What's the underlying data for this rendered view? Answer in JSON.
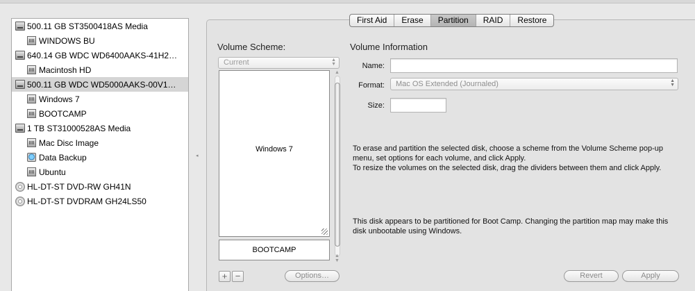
{
  "sidebar": {
    "items": [
      {
        "label": "500.11 GB ST3500418AS Media",
        "kind": "disk"
      },
      {
        "label": "WINDOWS BU",
        "kind": "volume"
      },
      {
        "label": "640.14 GB WDC WD6400AAKS-41H2…",
        "kind": "disk"
      },
      {
        "label": "Macintosh HD",
        "kind": "volume"
      },
      {
        "label": "500.11 GB WDC WD5000AAKS-00V1…",
        "kind": "disk",
        "selected": true
      },
      {
        "label": "Windows 7",
        "kind": "volume"
      },
      {
        "label": "BOOTCAMP",
        "kind": "volume"
      },
      {
        "label": "1 TB ST31000528AS Media",
        "kind": "disk"
      },
      {
        "label": "Mac Disc Image",
        "kind": "volume"
      },
      {
        "label": "Data Backup",
        "kind": "timemachine-volume"
      },
      {
        "label": "Ubuntu",
        "kind": "volume"
      },
      {
        "label": "HL-DT-ST DVD-RW GH41N",
        "kind": "optical"
      },
      {
        "label": "HL-DT-ST DVDRAM GH24LS50",
        "kind": "optical"
      }
    ]
  },
  "tabs": [
    {
      "label": "First Aid"
    },
    {
      "label": "Erase"
    },
    {
      "label": "Partition",
      "active": true
    },
    {
      "label": "RAID"
    },
    {
      "label": "Restore"
    }
  ],
  "scheme": {
    "title": "Volume Scheme:",
    "select_value": "Current",
    "partitions": [
      "Windows 7",
      "BOOTCAMP"
    ]
  },
  "info": {
    "title": "Volume Information",
    "name_label": "Name:",
    "name_value": "",
    "format_label": "Format:",
    "format_value": "Mac OS Extended (Journaled)",
    "size_label": "Size:",
    "size_value": "",
    "instructions_1": "To erase and partition the selected disk, choose a scheme from the Volume Scheme pop-up menu, set options for each volume, and click Apply.",
    "instructions_2": "To resize the volumes on the selected disk, drag the dividers between them and click Apply.",
    "bootcamp_note": "This disk appears to be partitioned for Boot Camp. Changing the partition map may make this disk unbootable using Windows."
  },
  "buttons": {
    "add": "+",
    "remove": "−",
    "options": "Options…",
    "revert": "Revert",
    "apply": "Apply"
  },
  "icons": {
    "disk": "hard-drive-icon",
    "volume": "volume-icon",
    "timemachine": "time-machine-volume-icon",
    "optical": "optical-disc-icon"
  }
}
